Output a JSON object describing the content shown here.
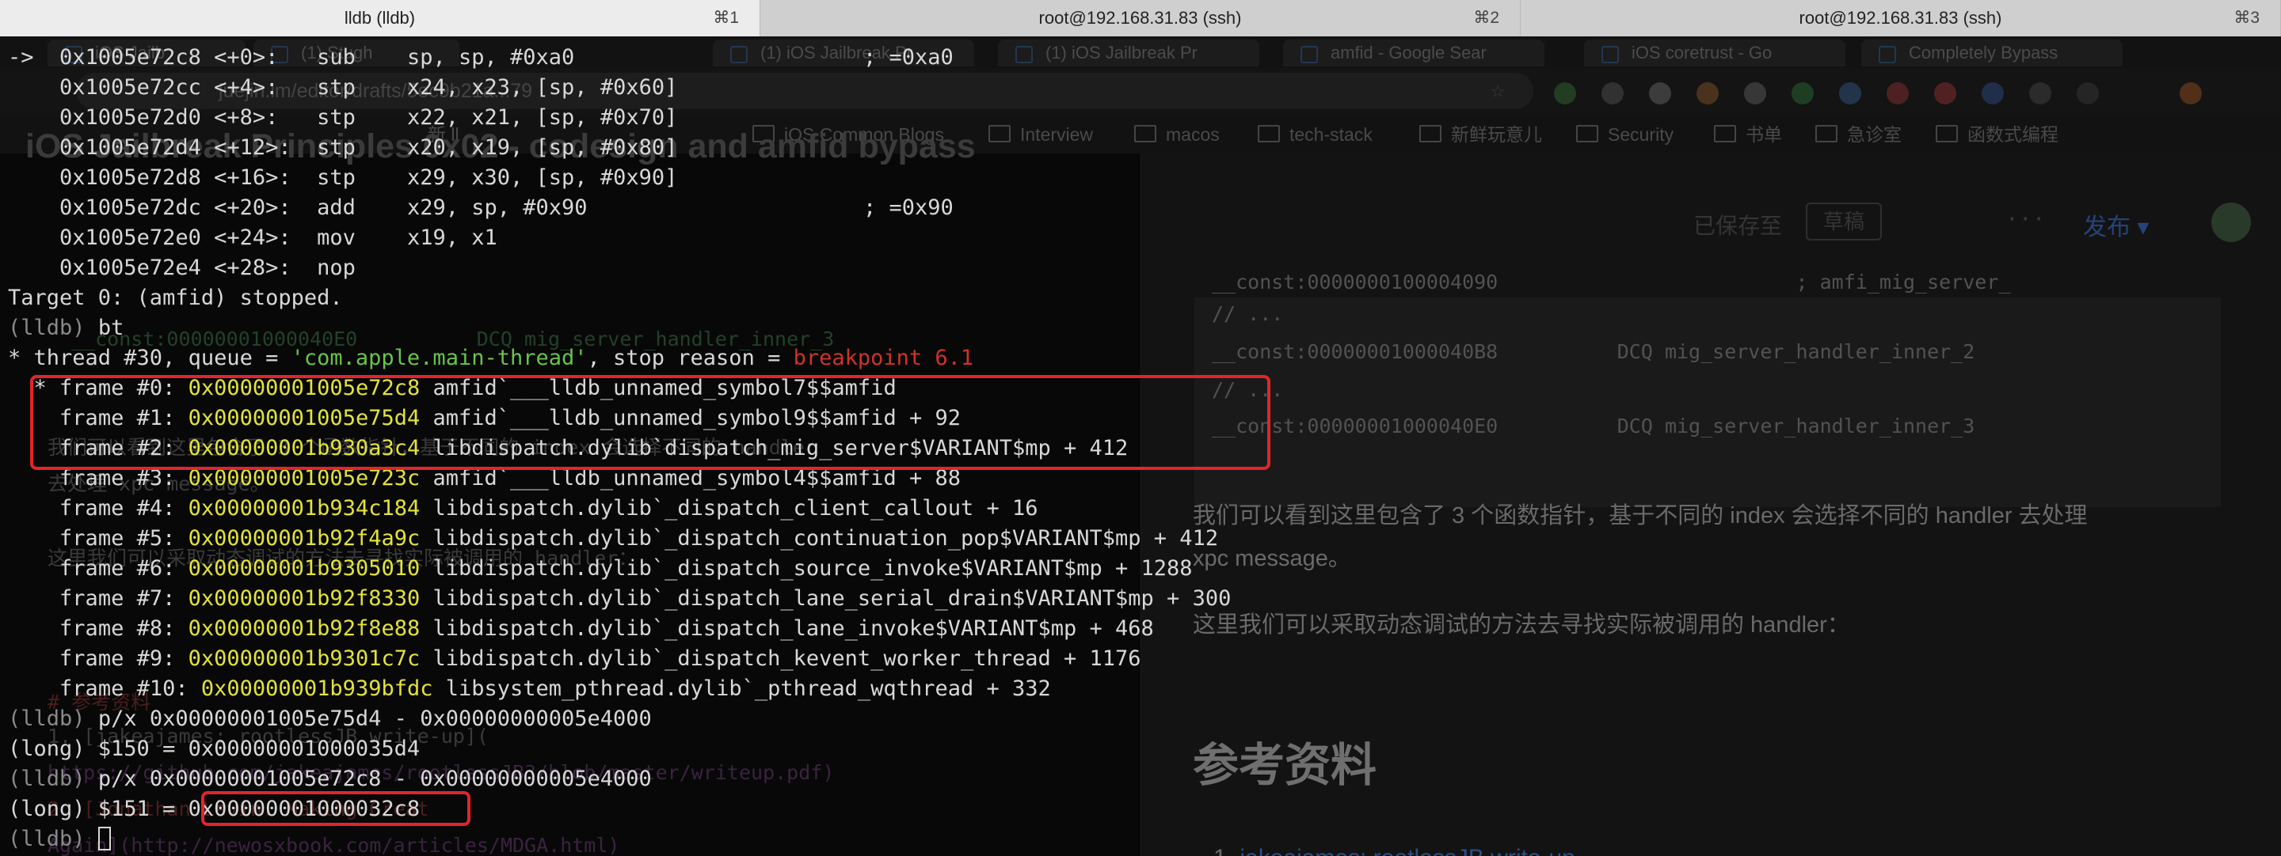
{
  "tabs": [
    {
      "title": "lldb (lldb)",
      "shortcut": "⌘1",
      "active": true
    },
    {
      "title": "root@192.168.31.83 (ssh)",
      "shortcut": "⌘2",
      "active": false
    },
    {
      "title": "root@192.168.31.83 (ssh)",
      "shortcut": "⌘3",
      "active": false
    }
  ],
  "background": {
    "browser_tabs": [
      "iOS Jailb",
      "(1) Stugh",
      "(1) iOS Jailbreak Pr",
      "(1) iOS Jailbreak Pr",
      "amfid - Google Sear",
      "iOS coretrust - Go",
      "Completely Bypass"
    ],
    "url": "juejin.im/editor/drafts/5ec9b21a...79",
    "bookmarks": [
      "新 ll",
      "iOS Common Blogs",
      "Interview",
      "macos",
      "tech-stack",
      "新鲜玩意儿",
      "Security",
      "书单",
      "急诊室",
      "函数式编程"
    ],
    "article_title": "iOS Jailbreak Principles 0x02 - codesign and amfid bypass",
    "draft_status": "已保存至",
    "draft_button": "草稿",
    "publish": "发布",
    "code_lines": [
      "__const:0000000100004090                         ; amfi_mig_server_",
      "// ...",
      "__const:00000001000040B8          DCQ mig_server_handler_inner_2",
      "// ...",
      "__const:00000001000040E0          DCQ mig_server_handler_inner_3"
    ],
    "para1": "我们可以看到这里包含了 3 个函数指针，基于不同的 index 会选择不同的 handler 去处理",
    "para1b": "xpc message。",
    "para2": "这里我们可以采取动态调试的方法去寻找实际被调用的 handler：",
    "heading": "参考资料",
    "list_item": "jakeajames: rootlessJB write-up",
    "left_code": "__const:00000001000040E0          DCQ mig_server_handler_inner_3",
    "left_para1": "我们可以看到这里包含了 3 个函数指针，基于不同的 index 会选择不同的 handler",
    "left_para1b": "去处理 xpc message。",
    "left_para2": "这里我们可以采取动态调试的方法去寻找实际被调用的 handler：",
    "left_heading": "# 参考资料",
    "left_link1": "1. [jakeajames: rootlessJB write-up](",
    "left_url1": "https://github.com/jakeajames/rootlessJB3/blob/master/writeup.pdf)",
    "left_link2": "2. [Jonathan Levin: Making Great",
    "left_url2": "Again](http://newosxbook.com/articles/MDGA.html)"
  },
  "terminal": {
    "disasm": [
      {
        "marker": "->",
        "addr": "0x1005e72c8",
        "off": "<+0>: ",
        "op": "sub ",
        "args": "sp, sp, #0xa0",
        "comment": "; =0xa0"
      },
      {
        "marker": "  ",
        "addr": "0x1005e72cc",
        "off": "<+4>: ",
        "op": "stp ",
        "args": "x24, x23, [sp, #0x60]",
        "comment": ""
      },
      {
        "marker": "  ",
        "addr": "0x1005e72d0",
        "off": "<+8>: ",
        "op": "stp ",
        "args": "x22, x21, [sp, #0x70]",
        "comment": ""
      },
      {
        "marker": "  ",
        "addr": "0x1005e72d4",
        "off": "<+12>:",
        "op": "stp ",
        "args": "x20, x19, [sp, #0x80]",
        "comment": ""
      },
      {
        "marker": "  ",
        "addr": "0x1005e72d8",
        "off": "<+16>:",
        "op": "stp ",
        "args": "x29, x30, [sp, #0x90]",
        "comment": ""
      },
      {
        "marker": "  ",
        "addr": "0x1005e72dc",
        "off": "<+20>:",
        "op": "add ",
        "args": "x29, sp, #0x90",
        "comment": "; =0x90"
      },
      {
        "marker": "  ",
        "addr": "0x1005e72e0",
        "off": "<+24>:",
        "op": "mov ",
        "args": "x19, x1",
        "comment": ""
      },
      {
        "marker": "  ",
        "addr": "0x1005e72e4",
        "off": "<+28>:",
        "op": "nop ",
        "args": "",
        "comment": ""
      }
    ],
    "stopped": "Target 0: (amfid) stopped.",
    "prompt": "(lldb)",
    "bt_cmd": "bt",
    "thread_prefix": "* thread #30, queue = ",
    "queue_name": "'com.apple.main-thread'",
    "stop_reason_prefix": ", stop reason = ",
    "stop_reason": "breakpoint 6.1",
    "frames": [
      {
        "label": "frame #0:",
        "sel": "*",
        "addr": "0x00000001005e72c8",
        "sym": "amfid`___lldb_unnamed_symbol7$$amfid"
      },
      {
        "label": "frame #1:",
        "sel": " ",
        "addr": "0x00000001005e75d4",
        "sym": "amfid`___lldb_unnamed_symbol9$$amfid + 92"
      },
      {
        "label": "frame #2:",
        "sel": " ",
        "addr": "0x00000001b930a3c4",
        "sym": "libdispatch.dylib`dispatch_mig_server$VARIANT$mp + 412"
      },
      {
        "label": "frame #3:",
        "sel": " ",
        "addr": "0x00000001005e723c",
        "sym": "amfid`___lldb_unnamed_symbol4$$amfid + 88"
      },
      {
        "label": "frame #4:",
        "sel": " ",
        "addr": "0x00000001b934c184",
        "sym": "libdispatch.dylib`_dispatch_client_callout + 16"
      },
      {
        "label": "frame #5:",
        "sel": " ",
        "addr": "0x00000001b92f4a9c",
        "sym": "libdispatch.dylib`_dispatch_continuation_pop$VARIANT$mp + 412"
      },
      {
        "label": "frame #6:",
        "sel": " ",
        "addr": "0x00000001b9305010",
        "sym": "libdispatch.dylib`_dispatch_source_invoke$VARIANT$mp + 1288"
      },
      {
        "label": "frame #7:",
        "sel": " ",
        "addr": "0x00000001b92f8330",
        "sym": "libdispatch.dylib`_dispatch_lane_serial_drain$VARIANT$mp + 300"
      },
      {
        "label": "frame #8:",
        "sel": " ",
        "addr": "0x00000001b92f8e88",
        "sym": "libdispatch.dylib`_dispatch_lane_invoke$VARIANT$mp + 468"
      },
      {
        "label": "frame #9:",
        "sel": " ",
        "addr": "0x00000001b9301c7c",
        "sym": "libdispatch.dylib`_dispatch_kevent_worker_thread + 1176"
      },
      {
        "label": "frame #10:",
        "sel": " ",
        "addr": "0x00000001b939bfdc",
        "sym": "libsystem_pthread.dylib`_pthread_wqthread + 332"
      }
    ],
    "cmd1": "p/x 0x00000001005e75d4 - 0x00000000005e4000",
    "res1_prefix": "(long) $150 = ",
    "res1_value": "0x00000001000035d4",
    "cmd2": "p/x 0x00000001005e72c8 - 0x00000000005e4000",
    "res2_prefix": "(long) $151 = ",
    "res2_value": "0x00000001000032c8",
    "final_prompt": "(lldb)"
  },
  "colors": {
    "address": "#e3e33c",
    "queue": "#67c54a",
    "stop_reason": "#d0322b",
    "highlight": "#e2252b"
  }
}
